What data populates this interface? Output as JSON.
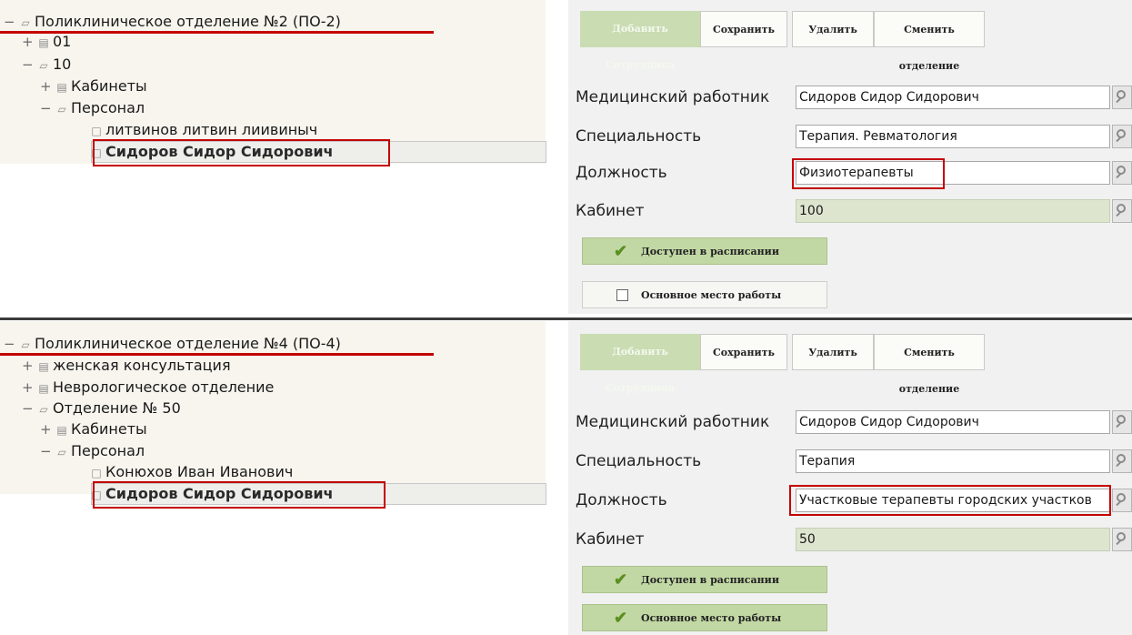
{
  "panels": [
    {
      "tree": [
        {
          "expander": "−",
          "icon": "▱",
          "label": "Поликлиническое отделение №2 (ПО-2)"
        },
        {
          "expander": "+",
          "icon": "▤",
          "label": "01"
        },
        {
          "expander": "−",
          "icon": "▱",
          "label": "10"
        },
        {
          "expander": "+",
          "icon": "▤",
          "label": "Кабинеты"
        },
        {
          "expander": "−",
          "icon": "▱",
          "label": "Персонал"
        },
        {
          "expander": "",
          "icon": "□",
          "label": "литвинов литвин лиивиныч"
        },
        {
          "expander": "",
          "icon": "□",
          "label": "Сидоров Сидор Сидорович"
        }
      ],
      "toolbar": {
        "add": "Добавить Сотрудника",
        "save": "Сохранить",
        "delete": "Удалить",
        "change": "Сменить отделение"
      },
      "fields": {
        "medic_label": "Медицинский работник",
        "medic_value": "Сидоров Сидор Сидорович",
        "spec_label": "Специальность",
        "spec_value": "Терапия. Ревматология",
        "post_label": "Должность",
        "post_value": "Физиотерапевты",
        "room_label": "Кабинет",
        "room_value": "100"
      },
      "buttons": {
        "schedule": "Доступен в расписании",
        "main_place": "Основное место работы"
      },
      "main_place_checked": false
    },
    {
      "tree": [
        {
          "expander": "−",
          "icon": "▱",
          "label": "Поликлиническое отделение №4 (ПО-4)"
        },
        {
          "expander": "+",
          "icon": "▤",
          "label": "женская консультация"
        },
        {
          "expander": "+",
          "icon": "▤",
          "label": "Неврологическое отделение"
        },
        {
          "expander": "−",
          "icon": "▱",
          "label": "Отделение № 50"
        },
        {
          "expander": "+",
          "icon": "▤",
          "label": "Кабинеты"
        },
        {
          "expander": "−",
          "icon": "▱",
          "label": "Персонал"
        },
        {
          "expander": "",
          "icon": "□",
          "label": "Конюхов Иван Иванович"
        },
        {
          "expander": "",
          "icon": "□",
          "label": "Сидоров Сидор Сидорович"
        }
      ],
      "toolbar": {
        "add": "Добавить Сотрудника",
        "save": "Сохранить",
        "delete": "Удалить",
        "change": "Сменить отделение"
      },
      "fields": {
        "medic_label": "Медицинский работник",
        "medic_value": "Сидоров Сидор Сидорович",
        "spec_label": "Специальность",
        "spec_value": "Терапия",
        "post_label": "Должность",
        "post_value": "Участковые терапевты городских участков",
        "room_label": "Кабинет",
        "room_value": "50"
      },
      "buttons": {
        "schedule": "Доступен в расписании",
        "main_place": "Основное место работы"
      },
      "main_place_checked": true
    }
  ],
  "colors": {
    "highlight": "#c40000",
    "accent_green": "#c2d8a4",
    "readonly": "#dde5cf"
  },
  "icons": {
    "search": "magnifier-icon",
    "check": "checkmark-icon",
    "folder_open": "folder-open-icon",
    "folder": "folder-icon",
    "doc": "document-icon"
  }
}
